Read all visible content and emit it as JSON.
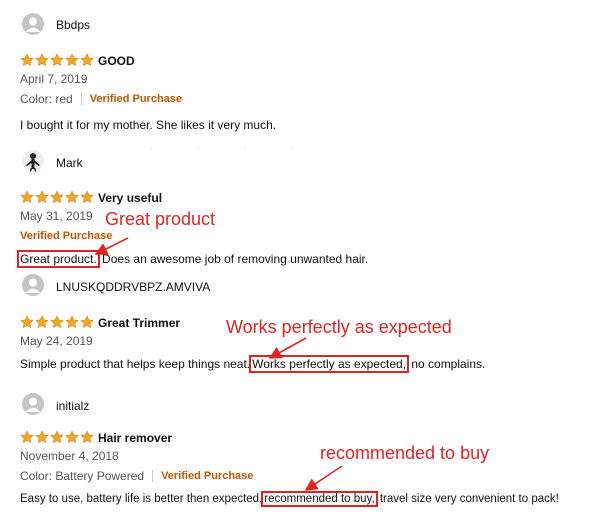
{
  "reviews": [
    {
      "username": "Bbdps",
      "title": "GOOD",
      "date": "April 7, 2019",
      "variant": "Color: red",
      "verified": "Verified Purchase",
      "body": "I bought it for my mother. She likes it very much."
    },
    {
      "username": "Mark",
      "title": "Very useful",
      "date": "May 31, 2019",
      "verified": "Verified Purchase",
      "body_highlight": "Great product.",
      "body_after": " Does an awesome job of removing unwanted hair."
    },
    {
      "username": "LNUSKQDDRVBPZ.AMVIVA",
      "title": "Great Trimmer",
      "date": "May 24, 2019",
      "body_before": "Simple product that helps keep things neat.",
      "body_highlight": "Works perfectly as expected,",
      "body_after": " no complains."
    },
    {
      "username": "initialz",
      "title": "Hair remover",
      "date": "November 4, 2018",
      "variant": "Color: Battery Powered",
      "verified": "Verified Purchase",
      "body_before": "Easy to use, battery life is better then expected,",
      "body_highlight": "recommended to buy,",
      "body_after": " travel size very convenient to pack!"
    }
  ],
  "annotations": {
    "a1": "Great product",
    "a2": "Works perfectly as expected",
    "a3": "recommended to buy"
  },
  "colors": {
    "star": "#f5a623",
    "verified": "#c45500",
    "annotation": "#e52222"
  }
}
